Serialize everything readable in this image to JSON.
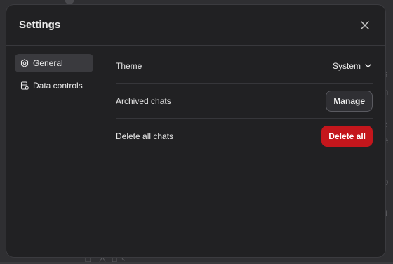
{
  "modal": {
    "title": "Settings"
  },
  "sidebar": {
    "items": [
      {
        "label": "General",
        "icon": "gear-icon",
        "active": true
      },
      {
        "label": "Data controls",
        "icon": "database-icon",
        "active": false
      }
    ]
  },
  "general": {
    "theme": {
      "label": "Theme",
      "value": "System"
    },
    "archived": {
      "label": "Archived chats",
      "button": "Manage"
    },
    "delete": {
      "label": "Delete all chats",
      "button": "Delete all"
    }
  },
  "background": {
    "right_text": [
      "ss",
      "on",
      "C",
      "tic",
      "be",
      "no",
      "ul",
      "ild",
      "ic"
    ]
  },
  "colors": {
    "danger": "#c4161c",
    "modal_bg": "#212123"
  }
}
